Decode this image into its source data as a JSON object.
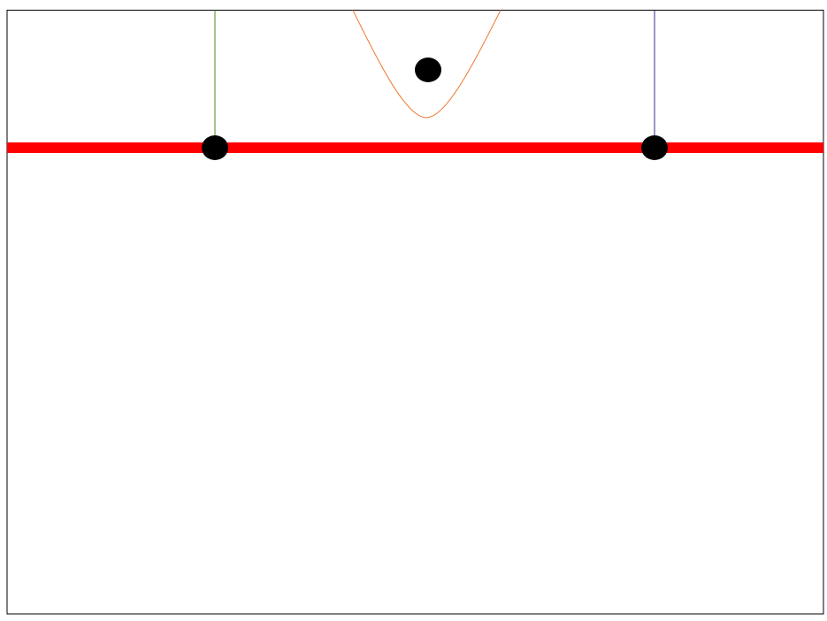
{
  "diagram": {
    "colors": {
      "background": "#ffffff",
      "frame": "#000000",
      "horizontal_line": "#ff0000",
      "left_vertical_line": "#4a8a1c",
      "right_vertical_line": "#3a2a8a",
      "curve": "#f07a30",
      "points": "#000000"
    }
  }
}
